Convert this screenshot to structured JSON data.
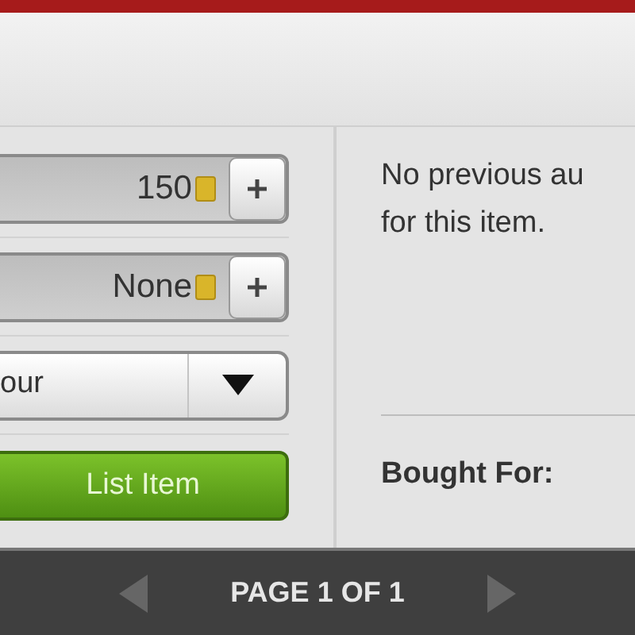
{
  "fields": [
    {
      "kind": "stepper",
      "value": "150",
      "coin": true
    },
    {
      "kind": "stepper",
      "value": "None",
      "coin": true
    },
    {
      "kind": "dropdown",
      "value": "our"
    }
  ],
  "list_button": {
    "label": "List Item"
  },
  "history": {
    "message_lines": [
      "No previous au",
      "for this item."
    ],
    "bought_for_label": "Bought For:"
  },
  "pager": {
    "label": "PAGE 1 OF 1",
    "prev_disabled": true,
    "next_disabled": true
  }
}
